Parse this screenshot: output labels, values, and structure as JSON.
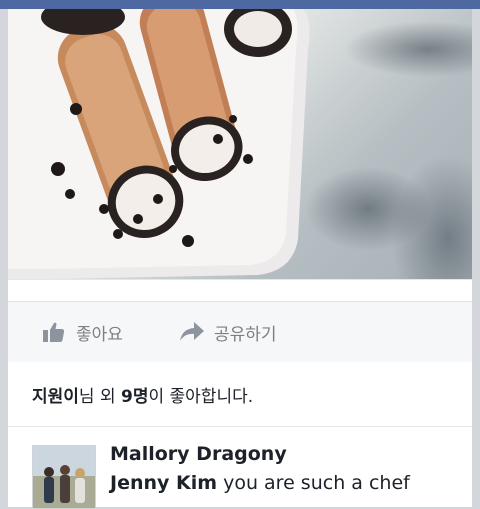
{
  "feed": {
    "post": {
      "photo_alt": "",
      "actions": {
        "like_label": "좋아요",
        "share_label": "공유하기"
      },
      "likes": {
        "name": "지원이",
        "suffix1": "님 외 ",
        "count": "9명",
        "suffix2": "이 좋아합니다."
      },
      "comment": {
        "author": "Mallory Dragony",
        "mention": "Jenny Kim",
        "text": " you are such a chef"
      }
    }
  },
  "colors": {
    "topbar": "#4e69a2",
    "action_text": "#7f7f7f",
    "text": "#1d2129"
  }
}
